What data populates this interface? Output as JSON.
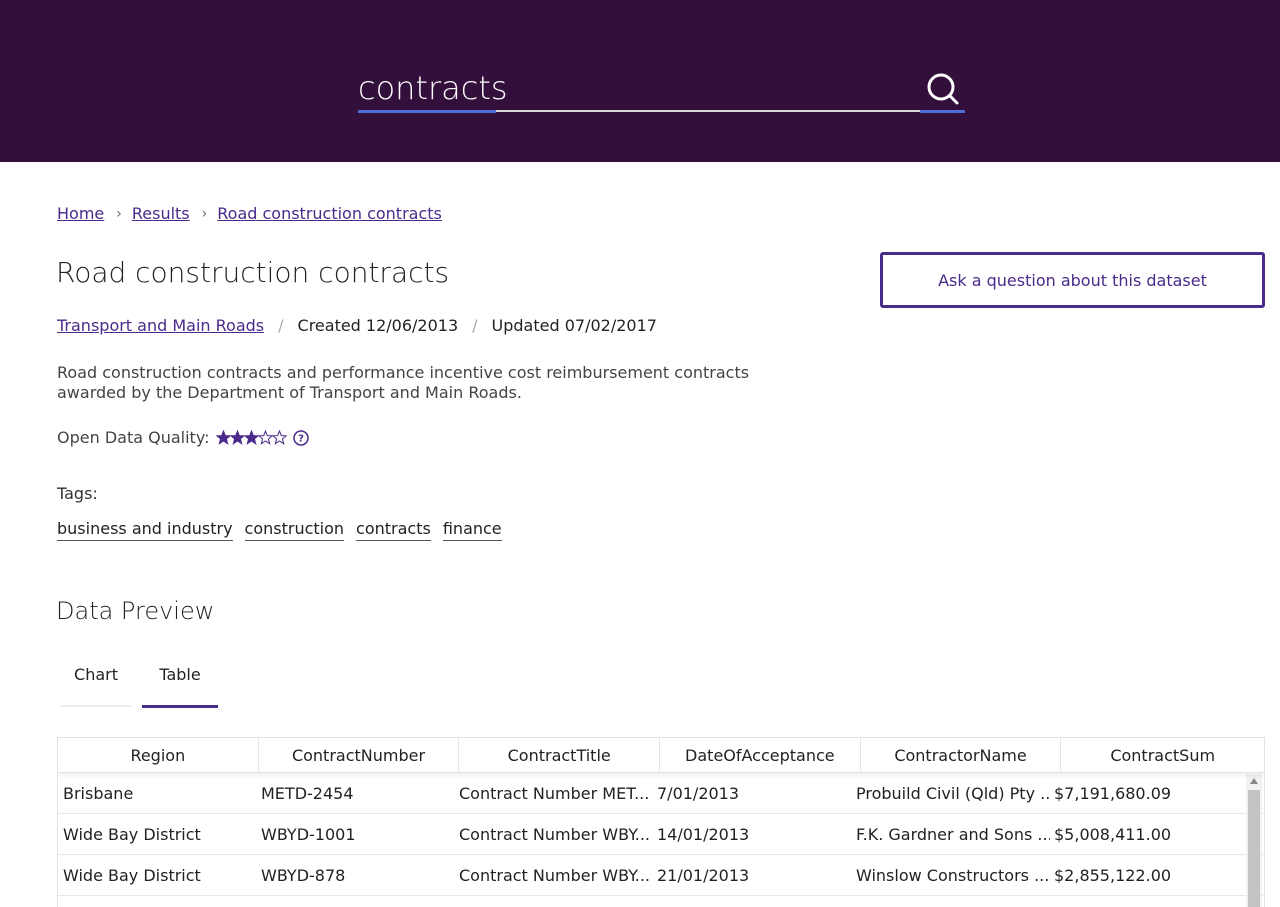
{
  "search": {
    "value": "contracts",
    "icon": "search-icon"
  },
  "breadcrumb": {
    "items": [
      {
        "label": "Home"
      },
      {
        "label": "Results"
      },
      {
        "label": "Road construction contracts"
      }
    ],
    "separator": "›"
  },
  "dataset": {
    "title": "Road construction contracts",
    "publisher": "Transport and Main Roads",
    "created": "Created 12/06/2013",
    "updated": "Updated 07/02/2017",
    "meta_separator": "/",
    "description": "Road construction contracts and performance incentive cost reimbursement contracts awarded by the Department of Transport and Main Roads.",
    "quality_label": "Open Data Quality:",
    "quality_stars": 3,
    "quality_max": 5,
    "tags_label": "Tags:",
    "tags": [
      "business and industry",
      "construction",
      "contracts",
      "finance"
    ]
  },
  "ask_button": {
    "label": "Ask a question about this dataset"
  },
  "preview": {
    "title": "Data Preview",
    "tabs": [
      {
        "label": "Chart",
        "active": false
      },
      {
        "label": "Table",
        "active": true
      }
    ]
  },
  "table": {
    "columns": [
      "Region",
      "ContractNumber",
      "ContractTitle",
      "DateOfAcceptance",
      "ContractorName",
      "ContractSum"
    ],
    "rows": [
      [
        "Brisbane",
        "METD-2454",
        "Contract Number MET...",
        "7/01/2013",
        "Probuild Civil (Qld) Pty ...",
        "$7,191,680.09"
      ],
      [
        "Wide Bay District",
        "WBYD-1001",
        "Contract Number WBY...",
        "14/01/2013",
        "F.K. Gardner and Sons ...",
        "$5,008,411.00"
      ],
      [
        "Wide Bay District",
        "WBYD-878",
        "Contract Number WBY...",
        "21/01/2013",
        "Winslow Constructors ...",
        "$2,855,122.00"
      ]
    ]
  },
  "colors": {
    "header_bg": "#33103c",
    "accent": "#4a2a8a",
    "search_accent": "#4f6ed6"
  }
}
